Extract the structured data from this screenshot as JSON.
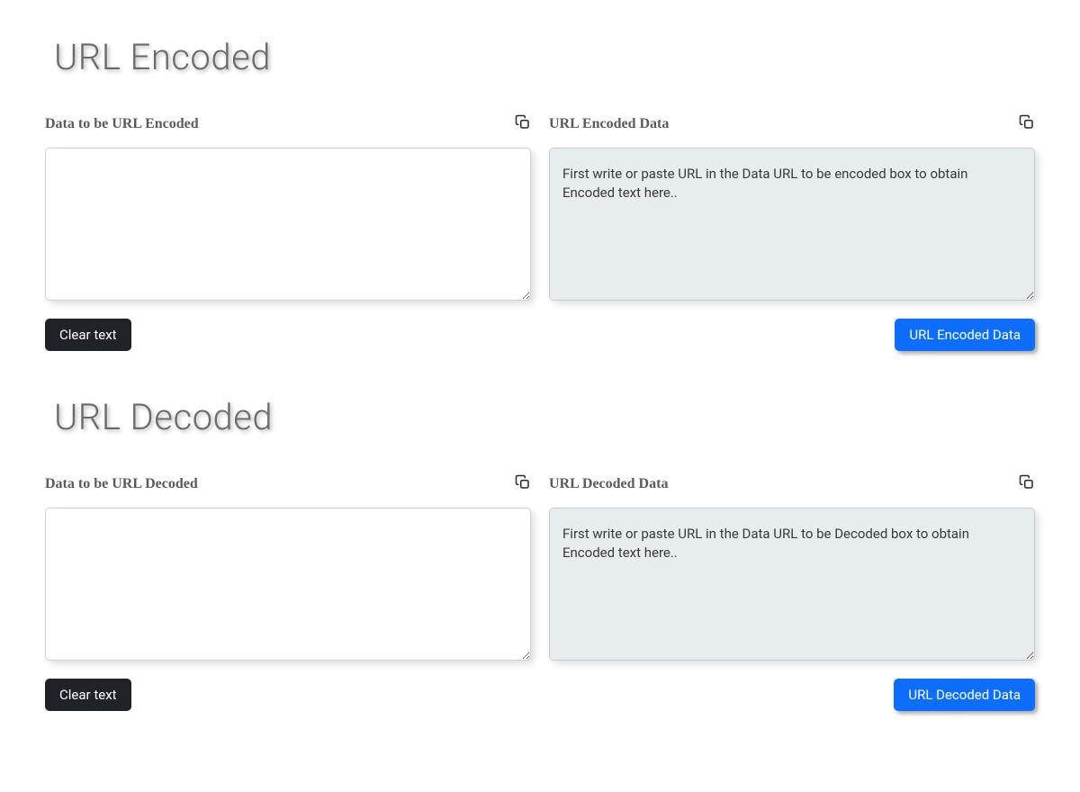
{
  "encoded_section": {
    "title": "URL Encoded",
    "input_label": "Data to be URL Encoded",
    "output_label": "URL Encoded Data",
    "input_value": "",
    "output_value": "First write or paste URL in the Data URL to be encoded box to obtain Encoded text here..",
    "clear_button": "Clear text",
    "action_button": "URL Encoded Data"
  },
  "decoded_section": {
    "title": "URL Decoded",
    "input_label": "Data to be URL Decoded",
    "output_label": "URL Decoded Data",
    "input_value": "",
    "output_value": "First write or paste URL in the Data URL to be Decoded box to obtain Encoded text here..",
    "clear_button": "Clear text",
    "action_button": "URL Decoded Data"
  }
}
